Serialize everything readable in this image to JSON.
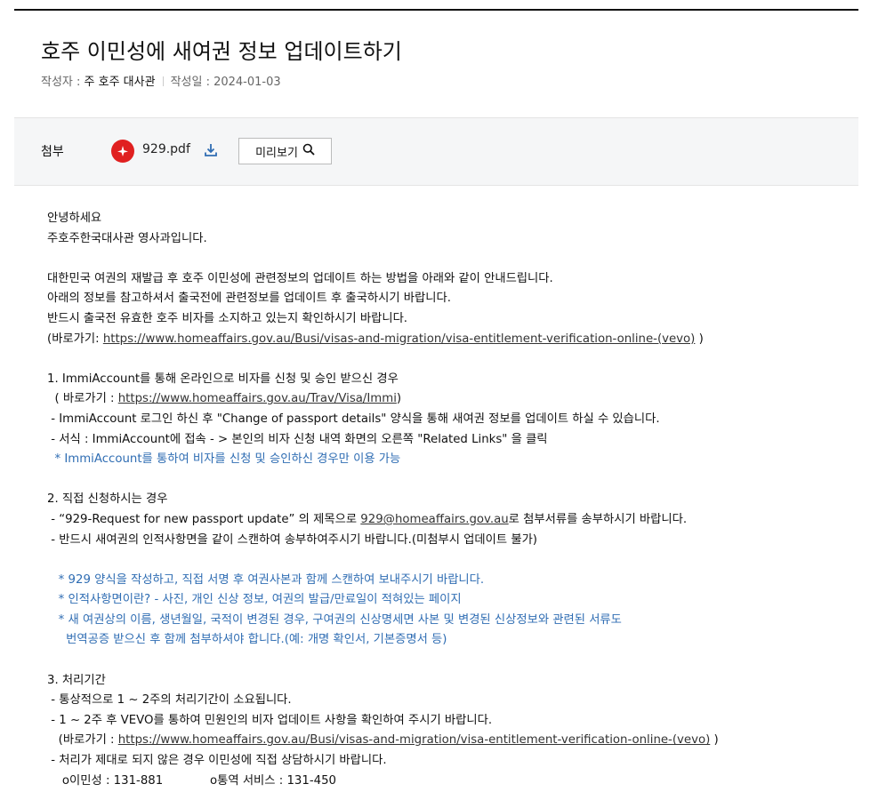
{
  "article": {
    "title": "호주 이민성에 새여권 정보 업데이트하기",
    "author_label": "작성자 : ",
    "author": "주 호주 대사관",
    "date_label": "작성일 : ",
    "date": "2024-01-03"
  },
  "attachment": {
    "label": "첨부",
    "file_icon": "pdf-icon",
    "file_name": "929.pdf",
    "download_icon": "download-icon",
    "preview_label": "미리보기",
    "preview_icon": "search-icon"
  },
  "body": {
    "greeting1": "안녕하세요",
    "greeting2": "주호주한국대사관 영사과입니다.",
    "intro1": "대한민국 여권의 재발급 후 호주 이민성에 관련정보의 업데이트 하는 방법을 아래와 같이 안내드립니다.",
    "intro2": "아래의 정보를 참고하셔서 출국전에 관련정보를 업데이트 후 출국하시기 바랍니다.",
    "intro3": "반드시 출국전 유효한 호주 비자를 소지하고 있는지 확인하시기 바랍니다.",
    "link_intro_prefix": "(바로가기: ",
    "link_vevo": "https://www.homeaffairs.gov.au/Busi/visas-and-migration/visa-entitlement-verification-online-(vevo)",
    "link_intro_suffix": " )",
    "s1_title": "1. ImmiAccount를 통해 온라인으로 비자를 신청 및 승인 받으신 경우",
    "s1_link_prefix": "  ( 바로가기 : ",
    "s1_link": "https://www.homeaffairs.gov.au/Trav/Visa/Immi",
    "s1_link_suffix": ")",
    "s1_b1": " - ImmiAccount 로그인 하신 후 \"Change of passport details\" 양식을 통해 새여권 정보를 업데이트 하실 수 있습니다.",
    "s1_b2": " - 서식 : ImmiAccount에 접속 - > 본인의 비자 신청 내역 화면의 오른쪽 \"Related Links\" 을 클릭",
    "s1_note": "  * ImmiAccount를 통하여 비자를 신청 및 승인하신 경우만 이용 가능",
    "s2_title": "2. 직접 신청하시는 경우",
    "s2_b1_prefix": " - “929-Request for new passport update” 의 제목으로 ",
    "s2_email": "929@homeaffairs.gov.au",
    "s2_b1_suffix": "로 첨부서류를 송부하시기 바랍니다.",
    "s2_b2": " - 반드시 새여권의 인적사항면을 같이 스캔하여 송부하여주시기 바랍니다.(미첨부시 업데이트 불가)",
    "s2_n1": "   * 929 양식을 작성하고, 직접 서명 후 여권사본과 함께 스캔하여 보내주시기 바랍니다.",
    "s2_n2": "   * 인적사항면이란? - 사진, 개인 신상 정보, 여권의 발급/만료일이 적혀있는 페이지",
    "s2_n3": "   * 새 여권상의 이름, 생년월일, 국적이 변경된 경우, 구여권의 신상명세면 사본 및 변경된 신상정보와 관련된 서류도",
    "s2_n4": "     번역공증 받으신 후 함께 첨부하셔야 합니다.(예: 개명 확인서, 기본증명서 등)",
    "s3_title": "3. 처리기간",
    "s3_b1": " - 통상적으로 1 ~ 2주의 처리기간이 소요됩니다.",
    "s3_b2": " - 1 ~ 2주 후 VEVO를 통하여 민원인의 비자 업데이트 사항을 확인하여 주시기 바랍니다.",
    "s3_link_prefix": "   (바로가기 : ",
    "s3_link": "https://www.homeaffairs.gov.au/Busi/visas-and-migration/visa-entitlement-verification-online-(vevo)",
    "s3_link_suffix": " )",
    "s3_b3": " - 처리가 제대로 되지 않은 경우 이민성에 직접 상담하시기 바랍니다.",
    "s3_c1": "    o이민성 : 131-881",
    "s3_c2": "o통역 서비스 : 131-450"
  }
}
